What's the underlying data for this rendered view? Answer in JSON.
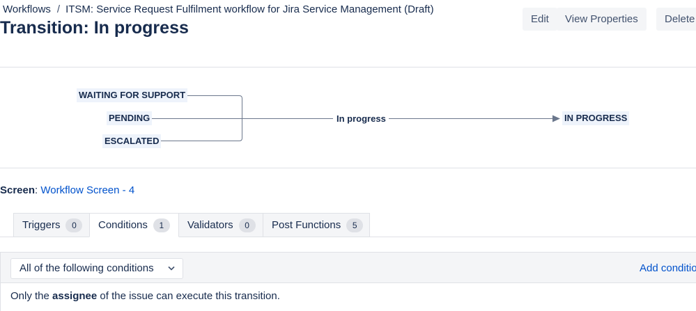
{
  "breadcrumb": {
    "root": "Workflows",
    "separator": "/",
    "current": "ITSM: Service Request Fulfilment workflow for Jira Service Management (Draft)"
  },
  "page_title": "Transition: In progress",
  "actions": {
    "edit": "Edit",
    "view_properties": "View Properties",
    "delete": "Delete"
  },
  "diagram": {
    "from_statuses": [
      "WAITING FOR SUPPORT",
      "PENDING",
      "ESCALATED"
    ],
    "transition": "In progress",
    "to_status": "IN PROGRESS",
    "line_color": "#6b778c",
    "lozenge_color": "#eef3fb"
  },
  "screen": {
    "label": "Screen",
    "value": "Workflow Screen - 4"
  },
  "tabs": [
    {
      "label": "Triggers",
      "count": "0"
    },
    {
      "label": "Conditions",
      "count": "1",
      "active": true
    },
    {
      "label": "Validators",
      "count": "0"
    },
    {
      "label": "Post Functions",
      "count": "5"
    }
  ],
  "conditions": {
    "group_select": "All of the following conditions",
    "add_link": "Add condition",
    "rules": [
      {
        "prefix": "Only the ",
        "emphasis": "assignee",
        "suffix": " of the issue can execute this transition."
      }
    ]
  },
  "colors": {
    "link": "#0052cc",
    "text": "#172b4d",
    "panel_bg": "#f4f5f7",
    "border": "#dfe1e6"
  }
}
